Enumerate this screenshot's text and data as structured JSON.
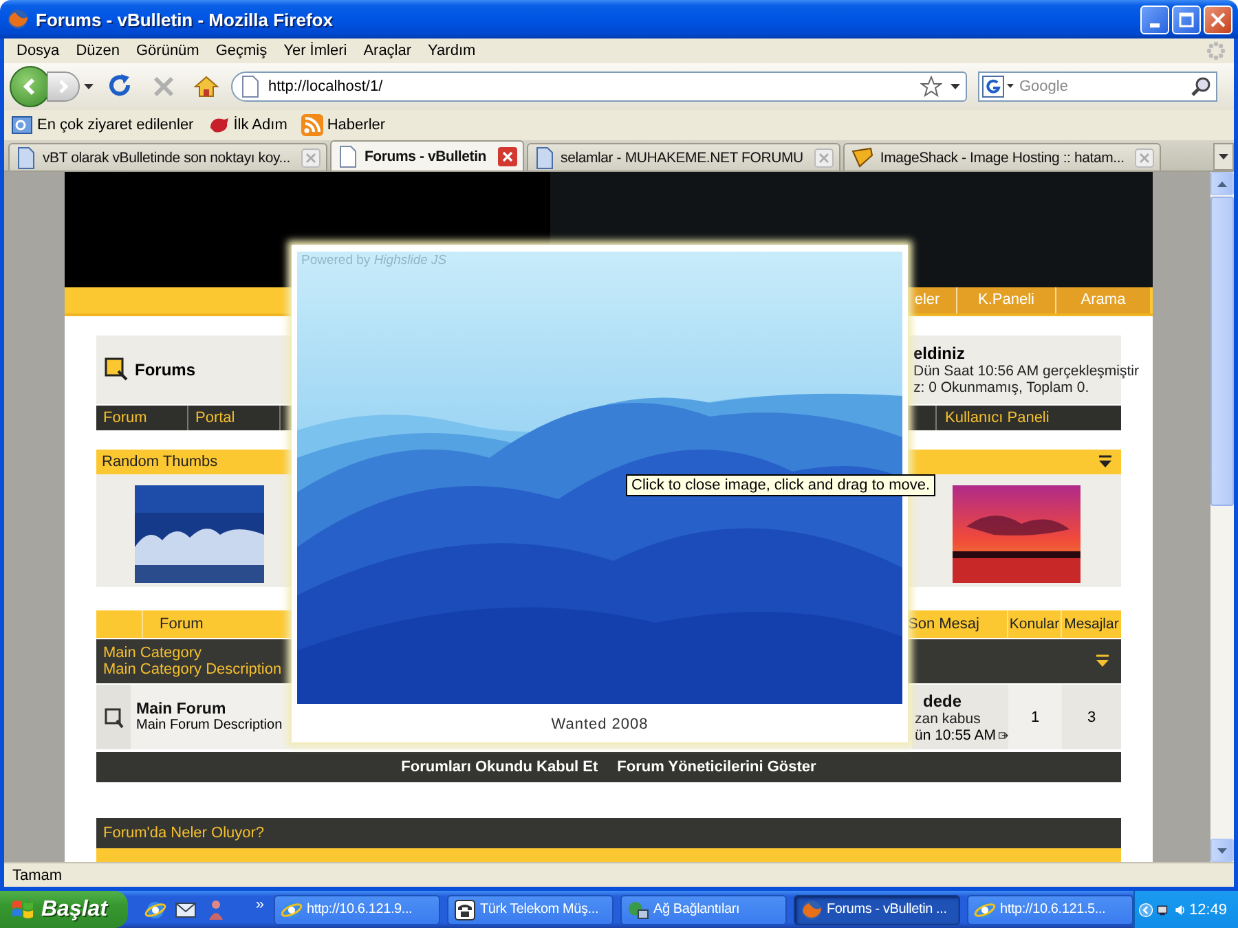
{
  "window": {
    "title": "Forums - vBulletin - Mozilla Firefox"
  },
  "menu": [
    "Dosya",
    "Düzen",
    "Görünüm",
    "Geçmiş",
    "Yer İmleri",
    "Araçlar",
    "Yardım"
  ],
  "address": {
    "url": "http://localhost/1/"
  },
  "search": {
    "placeholder": "Google"
  },
  "bookmarks": [
    "En çok ziyaret edilenler",
    "İlk Adım",
    "Haberler"
  ],
  "tabs": [
    {
      "label": "vBT olarak vBulletinde son noktayı koy...",
      "selected": false
    },
    {
      "label": "Forums - vBulletin",
      "selected": true
    },
    {
      "label": "selamlar - MUHAKEME.NET FORUMU",
      "selected": false
    },
    {
      "label": "ImageShack - Image Hosting :: hatam...",
      "selected": false
    }
  ],
  "page": {
    "header_nav": [
      "eler",
      "K.Paneli",
      "Arama"
    ],
    "breadcrumb": "Forums",
    "welcome": {
      "title": "eldiniz",
      "lines": [
        "Dün Saat 10:56 AM gerçekleşmiştir",
        "z: 0 Okunmamış, Toplam 0."
      ]
    },
    "navbar_left": [
      "Forum",
      "Portal"
    ],
    "navbar_right": [
      "Kullanıcı Paneli"
    ],
    "thumbs_title": "Random Thumbs",
    "forum_table": {
      "columns_left": [
        "Forum"
      ],
      "columns_right": [
        "Son Mesaj",
        "Konular",
        "Mesajlar"
      ],
      "category": {
        "name": "Main Category",
        "description": "Main Category Description"
      },
      "forums": [
        {
          "name": "Main Forum",
          "description": "Main Forum Description",
          "last_post_by": "dede",
          "last_post_title": "zan kabus",
          "last_post_time": "ün 10:55 AM",
          "threads": "1",
          "posts": "3"
        }
      ]
    },
    "footer_links": [
      "Forumları Okundu Kabul Et",
      "Forum Yöneticilerini Göster"
    ],
    "whats_going_on": "Forum'da Neler Oluyor?"
  },
  "image_popup": {
    "powered_by": "Powered by",
    "brand": "Highslide JS",
    "caption": "Wanted 2008",
    "tooltip": "Click to close image, click and drag to move."
  },
  "status_bar": "Tamam",
  "taskbar": {
    "start": "Başlat",
    "more": "»",
    "tasks": [
      {
        "label": "http://10.6.121.9...",
        "kind": "globe",
        "selected": false
      },
      {
        "label": "Türk Telekom Müş...",
        "kind": "phone",
        "selected": false
      },
      {
        "label": "Ağ Bağlantıları",
        "kind": "network",
        "selected": false
      },
      {
        "label": "Forums - vBulletin ...",
        "kind": "fox",
        "selected": true
      },
      {
        "label": "http://10.6.121.5...",
        "kind": "globe",
        "selected": false
      }
    ],
    "clock": "12:49"
  }
}
